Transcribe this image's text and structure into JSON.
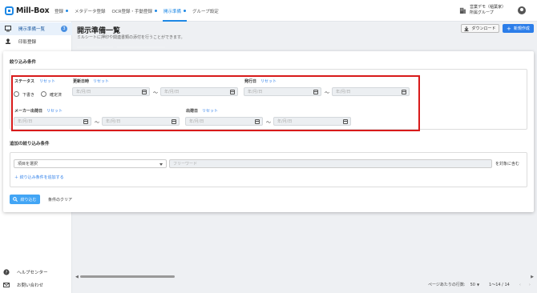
{
  "app": {
    "name": "Mill-Box"
  },
  "nav": [
    {
      "label": "登録",
      "dot": true
    },
    {
      "label": "メタデータ登録",
      "dot": false
    },
    {
      "label": "OCR登録・手動登録",
      "dot": true
    },
    {
      "label": "開示準備",
      "dot": true
    },
    {
      "label": "グループ設定",
      "dot": false
    }
  ],
  "org": {
    "name": "営業デモ（稲葉家）",
    "group": "所属グループ"
  },
  "sidebar": {
    "items": [
      {
        "label": "開示準備一覧",
        "badge": "3"
      },
      {
        "label": "印影登録"
      }
    ],
    "footer": [
      {
        "label": "ヘルプセンター"
      },
      {
        "label": "お問い合わせ"
      }
    ]
  },
  "page": {
    "title": "開示準備一覧",
    "subtitle": "ミルシートに押印や関連書類の添付を行うことができます。",
    "download_label": "ダウンロード",
    "new_label": "新規作成"
  },
  "filter": {
    "title": "絞り込み条件",
    "reset_label": "リセット",
    "status": {
      "label": "ステータス",
      "options": [
        "下書き",
        "確定済"
      ]
    },
    "updated": {
      "label": "更新日時",
      "from": "年/月/日",
      "to": "年/月/日"
    },
    "issued": {
      "label": "発行日",
      "from": "年/月/日",
      "to": "年/月/日"
    },
    "maker_shipped": {
      "label": "メーカー出荷日",
      "from": "年/月/日",
      "to": "年/月/日"
    },
    "shipped": {
      "label": "出荷日",
      "from": "年/月/日",
      "to": "年/月/日"
    },
    "range_sep": "〜"
  },
  "additional": {
    "title": "追加の絞り込み条件",
    "select_value": "項目を選択",
    "freeword_placeholder": "フリーワード",
    "target_suffix": "を対象に含む",
    "add_condition_label": "＋ 絞り込み条件を追加する",
    "filter_button": "絞り込む",
    "clear_button": "条件のクリア"
  },
  "pagination": {
    "rows_label": "ページあたりの行数:",
    "rows_value": "50",
    "range": "1〜14 / 14"
  },
  "colors": {
    "accent": "#2b7de9",
    "highlight": "#d81a1a",
    "filter_button": "#42a5f5"
  }
}
